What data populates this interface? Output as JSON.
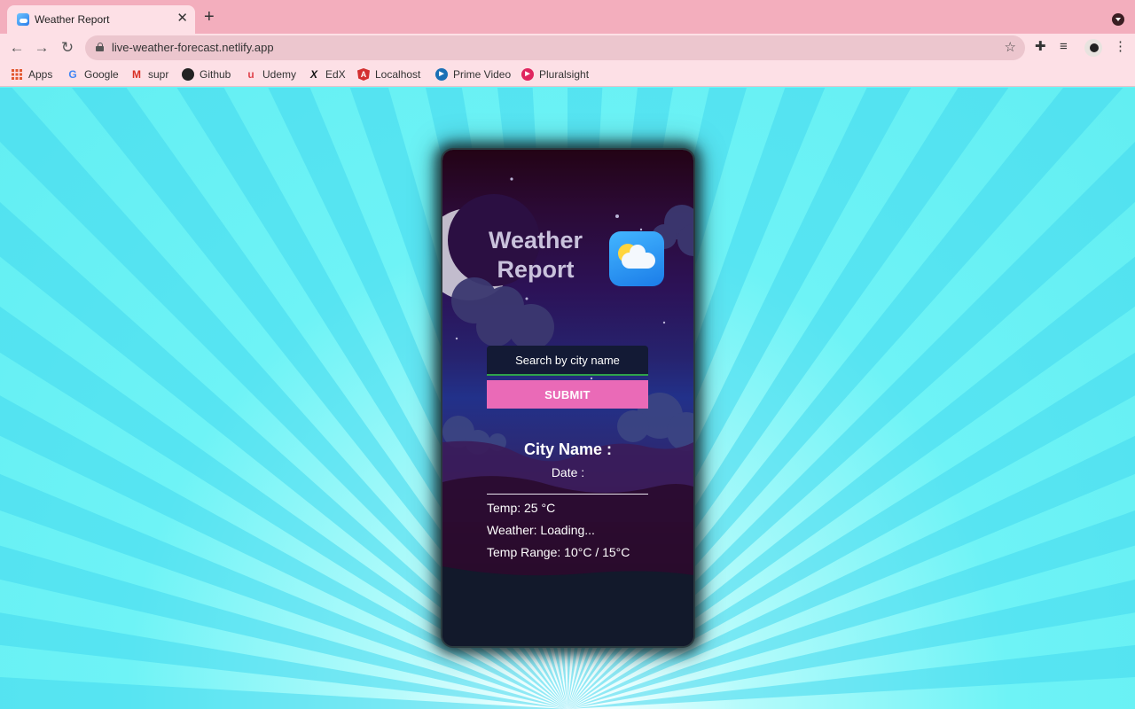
{
  "browser": {
    "tab_title": "Weather Report",
    "tab_close": "✕",
    "new_tab": "+",
    "url": "live-weather-forecast.netlify.app",
    "bookmarks": [
      {
        "label": "Apps",
        "icon": "apps-grid-icon"
      },
      {
        "label": "Google",
        "icon": "google-icon"
      },
      {
        "label": "supr",
        "icon": "gmail-icon"
      },
      {
        "label": "Github",
        "icon": "github-icon"
      },
      {
        "label": "Udemy",
        "icon": "udemy-icon"
      },
      {
        "label": "EdX",
        "icon": "edx-icon"
      },
      {
        "label": "Localhost",
        "icon": "angular-icon"
      },
      {
        "label": "Prime Video",
        "icon": "prime-video-icon"
      },
      {
        "label": "Pluralsight",
        "icon": "pluralsight-icon"
      }
    ]
  },
  "app": {
    "title_line1": "Weather",
    "title_line2": "Report",
    "search_placeholder": "Search by city name",
    "submit_label": "SUBMIT",
    "city_label": "City Name :",
    "date_label": "Date :",
    "temp": "Temp: 25 °C",
    "weather": "Weather: Loading...",
    "temp_range": "Temp Range: 10°C / 15°C"
  },
  "colors": {
    "accent": "#ea6ab7",
    "page_bg": "#6ef3f6",
    "chrome_tab": "#f3aebd",
    "chrome_toolbar": "#fde0e6"
  }
}
